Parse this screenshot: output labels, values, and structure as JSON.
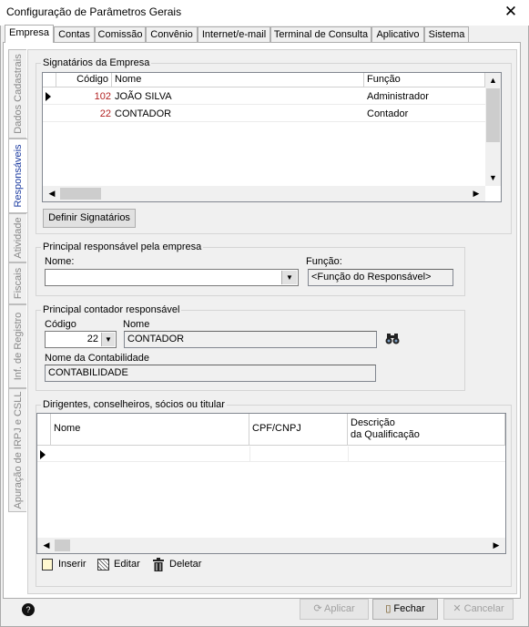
{
  "window": {
    "title": "Configuração de Parâmetros Gerais",
    "close_glyph": "✕"
  },
  "tabs": [
    "Empresa",
    "Contas",
    "Comissão",
    "Convênio",
    "Internet/e-mail",
    "Terminal de Consulta",
    "Aplicativo",
    "Sistema"
  ],
  "side_tabs": [
    "Dados Cadastrais",
    "Responsáveis",
    "Atividade",
    "Fiscais",
    "Inf. de Registro",
    "Apuração de IRPJ e CSLL"
  ],
  "signatarios": {
    "legend": "Signatários da Empresa",
    "columns": [
      "Código",
      "Nome",
      "Função"
    ],
    "rows": [
      {
        "codigo": "102",
        "nome": "JOÃO SILVA",
        "funcao": "Administrador"
      },
      {
        "codigo": "22",
        "nome": "CONTADOR",
        "funcao": "Contador"
      }
    ],
    "button": "Definir Signatários"
  },
  "principal": {
    "legend": "Principal responsável pela empresa",
    "nome_label": "Nome:",
    "funcao_label": "Função:",
    "funcao_value": "<Função do Responsável>"
  },
  "contador": {
    "legend": "Principal contador responsável",
    "codigo_label": "Código",
    "codigo_value": "22",
    "nome_label": "Nome",
    "nome_value": "CONTADOR",
    "contabilidade_label": "Nome da Contabilidade",
    "contabilidade_value": "CONTABILIDADE"
  },
  "dirigentes": {
    "legend": "Dirigentes, conselheiros, sócios ou titular",
    "col_nome": "Nome",
    "col_cpf": "CPF/CNPJ",
    "col_desc_1": "Descrição",
    "col_desc_2": "da Qualificação",
    "insert": "Inserir",
    "edit": "Editar",
    "delete": "Deletar"
  },
  "footer": {
    "apply": "Aplicar",
    "close": "Fechar",
    "cancel": "Cancelar"
  },
  "colors": {
    "code_red": "#b22222",
    "active_side_tab": "#1a3aa0"
  }
}
